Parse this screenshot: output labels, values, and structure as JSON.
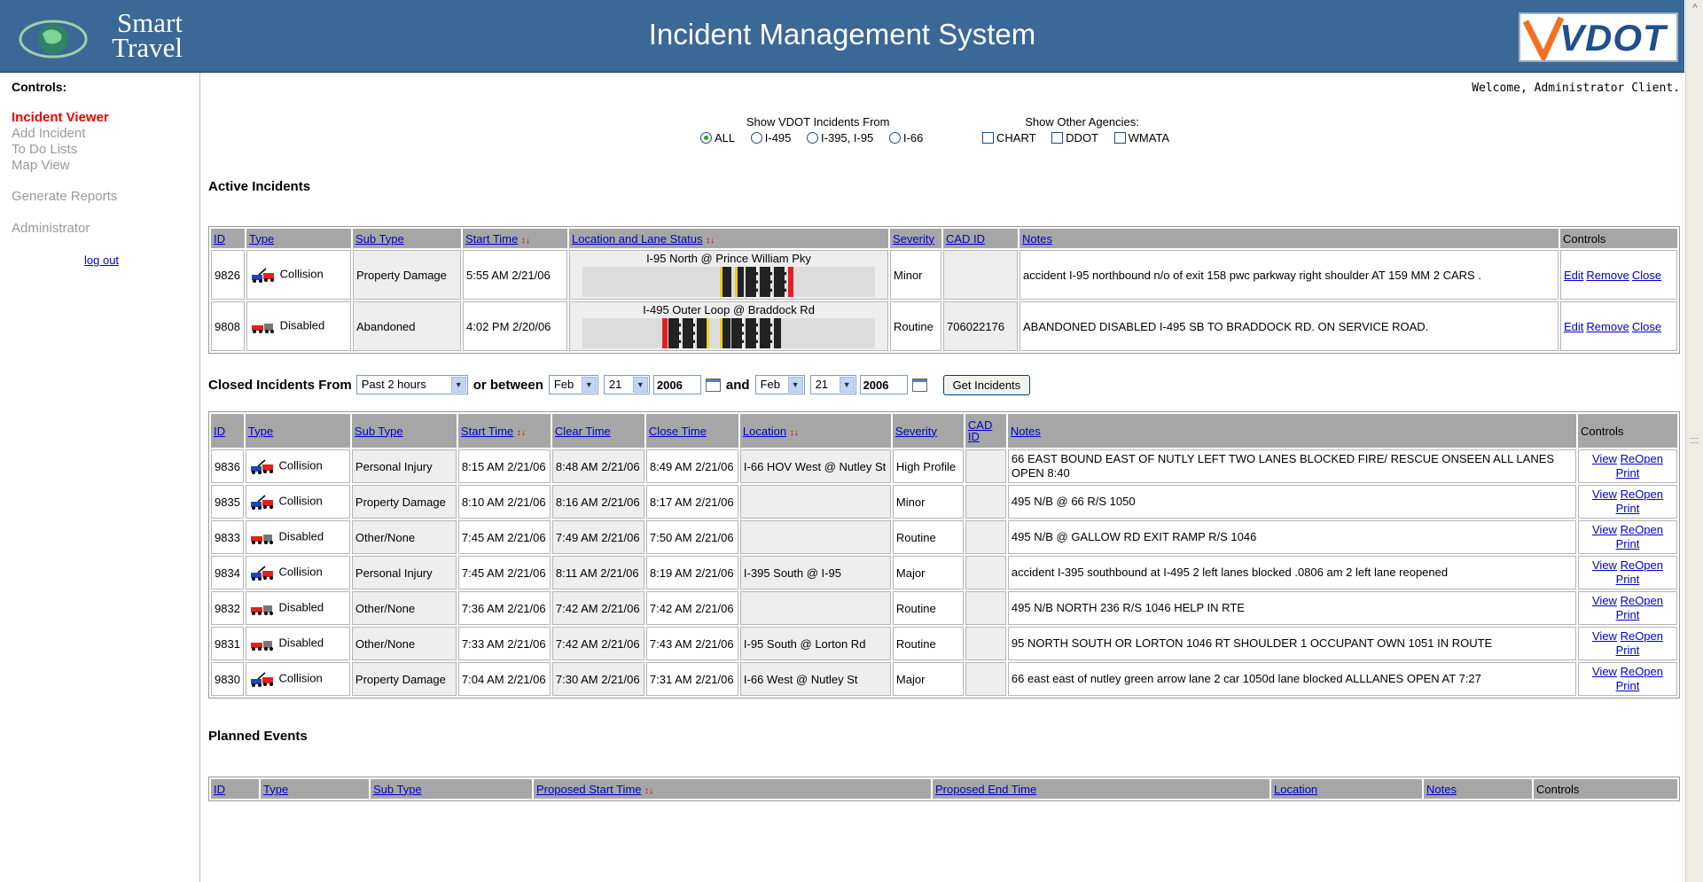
{
  "header": {
    "logo_line1": "Smart",
    "logo_line2": "Travel",
    "title": "Incident Management System",
    "vdot_logo": "VDOT"
  },
  "sidebar": {
    "heading": "Controls:",
    "items": [
      "Incident Viewer",
      "Add Incident",
      "To Do Lists",
      "Map View",
      "Generate Reports",
      "Administrator"
    ],
    "logout": "log out"
  },
  "welcome": "Welcome, Administrator Client.",
  "filters": {
    "vdot_label": "Show VDOT Incidents From",
    "vdot_options": [
      "ALL",
      "I-495",
      "I-395, I-95",
      "I-66"
    ],
    "vdot_selected": "ALL",
    "other_label": "Show Other Agencies:",
    "other_options": [
      "CHART",
      "DDOT",
      "WMATA"
    ]
  },
  "active": {
    "title": "Active Incidents",
    "headers": [
      "ID",
      "Type",
      "Sub Type",
      "Start Time",
      "Location and Lane Status",
      "Severity",
      "CAD ID",
      "Notes",
      "Controls"
    ],
    "rows": [
      {
        "id": "9826",
        "type": "Collision",
        "subtype": "Property Damage",
        "start": "5:55 AM 2/21/06",
        "location": "I-95 North @ Prince William Pky",
        "severity": "Minor",
        "cad": "",
        "notes": "accident I-95 northbound n/o of exit 158 pwc parkway right shoulder AT 159 MM 2 CARS .",
        "edit": "Edit",
        "remove": "Remove",
        "close": "Close"
      },
      {
        "id": "9808",
        "type": "Disabled",
        "subtype": "Abandoned",
        "start": "4:02 PM 2/20/06",
        "location": "I-495 Outer Loop @ Braddock Rd",
        "severity": "Routine",
        "cad": "706022176",
        "notes": "ABANDONED DISABLED I-495 SB TO BRADDOCK RD. ON SERVICE ROAD.",
        "edit": "Edit",
        "remove": "Remove",
        "close": "Close"
      }
    ]
  },
  "closed_filter": {
    "label": "Closed Incidents From",
    "range": "Past 2 hours",
    "or_between": "or between",
    "from_month": "Feb",
    "from_day": "21",
    "from_year": "2006",
    "and": "and",
    "to_month": "Feb",
    "to_day": "21",
    "to_year": "2006",
    "button": "Get Incidents"
  },
  "closed": {
    "headers": [
      "ID",
      "Type",
      "Sub Type",
      "Start Time",
      "Clear Time",
      "Close Time",
      "Location",
      "Severity",
      "CAD ID",
      "Notes",
      "Controls"
    ],
    "rows": [
      {
        "id": "9836",
        "type": "Collision",
        "subtype": "Personal Injury",
        "start": "8:15 AM 2/21/06",
        "clear": "8:48 AM 2/21/06",
        "close": "8:49 AM 2/21/06",
        "location": "I-66 HOV West @ Nutley St",
        "severity": "High Profile",
        "cad": "",
        "notes": "66 EAST BOUND EAST OF NUTLY LEFT TWO LANES BLOCKED FIRE/ RESCUE ONSEEN ALL LANES OPEN 8:40"
      },
      {
        "id": "9835",
        "type": "Collision",
        "subtype": "Property Damage",
        "start": "8:10 AM 2/21/06",
        "clear": "8:16 AM 2/21/06",
        "close": "8:17 AM 2/21/06",
        "location": "",
        "severity": "Minor",
        "cad": "",
        "notes": "495 N/B @ 66 R/S 1050"
      },
      {
        "id": "9833",
        "type": "Disabled",
        "subtype": "Other/None",
        "start": "7:45 AM 2/21/06",
        "clear": "7:49 AM 2/21/06",
        "close": "7:50 AM 2/21/06",
        "location": "",
        "severity": "Routine",
        "cad": "",
        "notes": "495 N/B @ GALLOW RD EXIT RAMP R/S 1046"
      },
      {
        "id": "9834",
        "type": "Collision",
        "subtype": "Personal Injury",
        "start": "7:45 AM 2/21/06",
        "clear": "8:11 AM 2/21/06",
        "close": "8:19 AM 2/21/06",
        "location": "I-395 South @ I-95",
        "severity": "Major",
        "cad": "",
        "notes": "accident I-395 southbound at I-495 2 left lanes blocked .0806 am 2 left lane reopened"
      },
      {
        "id": "9832",
        "type": "Disabled",
        "subtype": "Other/None",
        "start": "7:36 AM 2/21/06",
        "clear": "7:42 AM 2/21/06",
        "close": "7:42 AM 2/21/06",
        "location": "",
        "severity": "Routine",
        "cad": "",
        "notes": "495 N/B NORTH 236 R/S 1046 HELP IN RTE"
      },
      {
        "id": "9831",
        "type": "Disabled",
        "subtype": "Other/None",
        "start": "7:33 AM 2/21/06",
        "clear": "7:42 AM 2/21/06",
        "close": "7:43 AM 2/21/06",
        "location": "I-95 South @ Lorton Rd",
        "severity": "Routine",
        "cad": "",
        "notes": "95 NORTH SOUTH OR LORTON 1046 RT SHOULDER 1 OCCUPANT OWN 1051 IN ROUTE"
      },
      {
        "id": "9830",
        "type": "Collision",
        "subtype": "Property Damage",
        "start": "7:04 AM 2/21/06",
        "clear": "7:30 AM 2/21/06",
        "close": "7:31 AM 2/21/06",
        "location": "I-66 West @ Nutley St",
        "severity": "Major",
        "cad": "",
        "notes": "66 east east of nutley green arrow lane 2 car 1050d lane blocked ALLLANES OPEN AT 7:27"
      }
    ],
    "view": "View",
    "reopen": "ReOpen",
    "print": "Print"
  },
  "planned": {
    "title": "Planned Events",
    "headers": [
      "ID",
      "Type",
      "Sub Type",
      "Proposed Start Time",
      "Proposed End Time",
      "Location",
      "Notes",
      "Controls"
    ]
  },
  "icons": {
    "collision": "collision-icon",
    "disabled": "disabled-vehicle-icon",
    "sort": "sort-arrows-icon",
    "calendar": "calendar-icon"
  }
}
